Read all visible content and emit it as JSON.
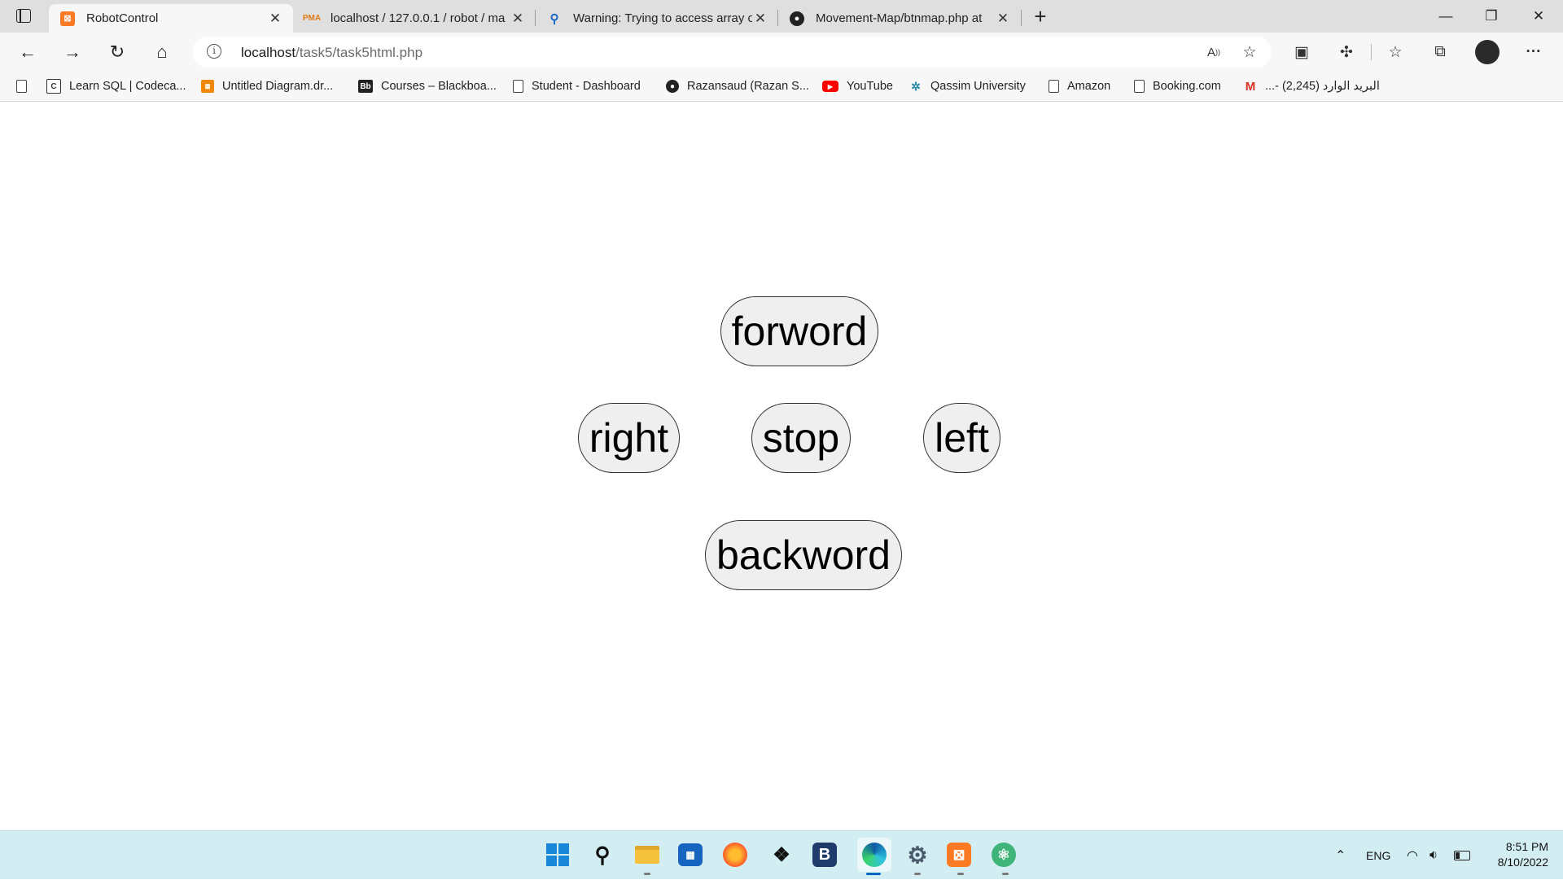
{
  "browser": {
    "tabs": [
      {
        "title": "RobotControl",
        "favicon": "xampp-icon",
        "active": true
      },
      {
        "title": "localhost / 127.0.0.1 / robot / ma",
        "favicon": "phpmyadmin-icon",
        "active": false
      },
      {
        "title": "Warning: Trying to access array o",
        "favicon": "search-icon",
        "active": false
      },
      {
        "title": "Movement-Map/btnmap.php at",
        "favicon": "github-icon",
        "active": false
      }
    ],
    "new_tab": "+",
    "address": {
      "host": "localhost",
      "path": "/task5/task5html.php"
    }
  },
  "bookmarks": [
    {
      "label": "Learn SQL | Codeca...",
      "icon": "codecademy-icon"
    },
    {
      "label": "Untitled Diagram.dr...",
      "icon": "drawio-icon"
    },
    {
      "label": "Courses – Blackboa...",
      "icon": "blackboard-icon"
    },
    {
      "label": "Student - Dashboard",
      "icon": "page-icon"
    },
    {
      "label": "Razansaud (Razan S...",
      "icon": "github-icon"
    },
    {
      "label": "YouTube",
      "icon": "youtube-icon"
    },
    {
      "label": "Qassim University",
      "icon": "university-icon"
    },
    {
      "label": "Amazon",
      "icon": "page-icon"
    },
    {
      "label": "Booking.com",
      "icon": "page-icon"
    },
    {
      "label": "البريد الوارد (2,245) -...",
      "icon": "gmail-icon"
    }
  ],
  "controls": {
    "forward": "forword",
    "right": "right",
    "stop": "stop",
    "left": "left",
    "backward": "backword"
  },
  "taskbar": {
    "tray": {
      "language": "ENG",
      "time": "8:51 PM",
      "date": "8/10/2022"
    }
  }
}
